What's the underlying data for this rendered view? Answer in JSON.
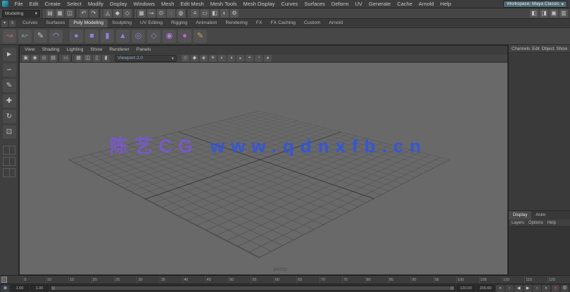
{
  "menubar": {
    "items": [
      "File",
      "Edit",
      "Create",
      "Select",
      "Modify",
      "Display",
      "Windows",
      "Mesh",
      "Edit Mesh",
      "Mesh Tools",
      "Mesh Display",
      "Curves",
      "Surfaces",
      "Deform",
      "UV",
      "Generate",
      "Cache",
      "Arnold",
      "Help"
    ],
    "workspace": "Workspace: Maya Classic",
    "workspace_arrow": "▾"
  },
  "statusline": {
    "menuset": "Modeling",
    "menuset_arrow": "▾",
    "icons": [
      {
        "name": "separator",
        "glyph": ""
      },
      {
        "name": "new-scene-icon",
        "glyph": "▤"
      },
      {
        "name": "open-scene-icon",
        "glyph": "▦"
      },
      {
        "name": "save-scene-icon",
        "glyph": "◫"
      },
      {
        "name": "separator",
        "glyph": ""
      },
      {
        "name": "undo-icon",
        "glyph": "↶"
      },
      {
        "name": "redo-icon",
        "glyph": "↷"
      },
      {
        "name": "separator",
        "glyph": ""
      },
      {
        "name": "select-hierarchy-icon",
        "glyph": "◬"
      },
      {
        "name": "select-object-icon",
        "glyph": "◆"
      },
      {
        "name": "select-component-icon",
        "glyph": "◇"
      },
      {
        "name": "separator",
        "glyph": ""
      },
      {
        "name": "snap-grid-icon",
        "glyph": "▦"
      },
      {
        "name": "snap-curve-icon",
        "glyph": "↝"
      },
      {
        "name": "snap-point-icon",
        "glyph": "⊙"
      },
      {
        "name": "snap-plane-icon",
        "glyph": "◌"
      },
      {
        "name": "make-live-icon",
        "glyph": "◍"
      },
      {
        "name": "separator",
        "glyph": ""
      },
      {
        "name": "construction-history-icon",
        "glyph": "≡"
      },
      {
        "name": "open-render-view-icon",
        "glyph": "▭"
      },
      {
        "name": "render-frame-icon",
        "glyph": "◧"
      },
      {
        "name": "ipr-render-icon",
        "glyph": "◐"
      },
      {
        "name": "render-settings-icon",
        "glyph": "⚙"
      }
    ],
    "right_icons": [
      {
        "name": "modeling-toolkit-icon",
        "glyph": "◧"
      },
      {
        "name": "attribute-editor-icon",
        "glyph": "◨"
      },
      {
        "name": "tool-settings-icon",
        "glyph": "▣"
      },
      {
        "name": "channel-box-icon",
        "glyph": "▥"
      }
    ]
  },
  "shelf": {
    "menu_icons": [
      {
        "name": "shelf-tab-menu-icon",
        "glyph": "▾"
      },
      {
        "name": "shelf-edit-menu-icon",
        "glyph": "≡"
      }
    ],
    "tabs": [
      {
        "label": "Curves",
        "active": false
      },
      {
        "label": "Surfaces",
        "active": false
      },
      {
        "label": "Poly Modeling",
        "active": true
      },
      {
        "label": "Sculpting",
        "active": false
      },
      {
        "label": "UV Editing",
        "active": false
      },
      {
        "label": "Rigging",
        "active": false
      },
      {
        "label": "Animation",
        "active": false
      },
      {
        "label": "Rendering",
        "active": false
      },
      {
        "label": "FX",
        "active": false
      },
      {
        "label": "FX Caching",
        "active": false
      },
      {
        "label": "Custom",
        "active": false
      },
      {
        "label": "Arnold",
        "active": false
      }
    ],
    "icons": [
      {
        "name": "ep-curve-icon",
        "glyph": "↝",
        "color": "#cc6666"
      },
      {
        "name": "cv-curve-icon",
        "glyph": "↜",
        "color": "#66aa88"
      },
      {
        "name": "pencil-curve-icon",
        "glyph": "✎",
        "color": "#cccccc"
      },
      {
        "name": "arc-tool-icon",
        "glyph": "◠",
        "color": "#99aadd"
      },
      {
        "name": "shelf-separator",
        "glyph": "",
        "color": ""
      },
      {
        "name": "poly-sphere-icon",
        "glyph": "●",
        "color": "#8f7fd9"
      },
      {
        "name": "poly-cube-icon",
        "glyph": "■",
        "color": "#8f7fd9"
      },
      {
        "name": "poly-cylinder-icon",
        "glyph": "▮",
        "color": "#8f7fd9"
      },
      {
        "name": "poly-cone-icon",
        "glyph": "▲",
        "color": "#8f7fd9"
      },
      {
        "name": "poly-torus-icon",
        "glyph": "◎",
        "color": "#8f7fd9"
      },
      {
        "name": "poly-plane-icon",
        "glyph": "◇",
        "color": "#8f7fd9"
      },
      {
        "name": "poly-disc-icon",
        "glyph": "◉",
        "color": "#b57fd9"
      },
      {
        "name": "sculpt-sphere-icon",
        "glyph": "●",
        "color": "#c75fd0"
      },
      {
        "name": "sculpt-brush-icon",
        "glyph": "✎",
        "color": "#d0a05f"
      }
    ]
  },
  "toolbox": {
    "tools": [
      {
        "name": "select-tool-icon",
        "glyph": "►"
      },
      {
        "name": "lasso-tool-icon",
        "glyph": "∽"
      },
      {
        "name": "paint-select-tool-icon",
        "glyph": "✎"
      },
      {
        "name": "move-tool-icon",
        "glyph": "✚"
      },
      {
        "name": "rotate-tool-icon",
        "glyph": "↻"
      },
      {
        "name": "scale-tool-icon",
        "glyph": "⊡"
      }
    ],
    "layouts": [
      {
        "name": "layout-single-button"
      },
      {
        "name": "layout-four-pane-button"
      },
      {
        "name": "layout-persp-outliner-button"
      }
    ]
  },
  "viewportpanel": {
    "menus": [
      "View",
      "Shading",
      "Lighting",
      "Show",
      "Renderer",
      "Panels"
    ],
    "toolbar_left": [
      {
        "name": "camera-select-icon",
        "glyph": "▣"
      },
      {
        "name": "camera-lock-icon",
        "glyph": "◉"
      },
      {
        "name": "camera-attributes-icon",
        "glyph": "◎"
      },
      {
        "name": "bookmark-icon",
        "glyph": "▤"
      },
      {
        "name": "separator",
        "glyph": ""
      },
      {
        "name": "image-plane-icon",
        "glyph": "▭"
      },
      {
        "name": "separator",
        "glyph": ""
      },
      {
        "name": "grid-toggle-icon",
        "glyph": "▦"
      },
      {
        "name": "film-gate-icon",
        "glyph": "◫"
      },
      {
        "name": "resolution-gate-icon",
        "glyph": "▯"
      },
      {
        "name": "gate-mask-icon",
        "glyph": "▮"
      }
    ],
    "renderer_dropdown": "Viewport 2.0",
    "dropdown_arrow": "▾",
    "toolbar_right": [
      {
        "name": "wireframe-icon",
        "glyph": "◇"
      },
      {
        "name": "shaded-icon",
        "glyph": "◆"
      },
      {
        "name": "textured-icon",
        "glyph": "◈"
      },
      {
        "name": "lights-icon",
        "glyph": "☀"
      },
      {
        "name": "shadows-icon",
        "glyph": "◐"
      },
      {
        "name": "screen-ao-icon",
        "glyph": "◑"
      },
      {
        "name": "motion-blur-icon",
        "glyph": "◒"
      },
      {
        "name": "anti-alias-icon",
        "glyph": "◓"
      },
      {
        "name": "xray-icon",
        "glyph": "◔"
      },
      {
        "name": "isolate-select-icon",
        "glyph": "◕"
      }
    ],
    "camera_label": "persp",
    "watermark_cn": "陈艺CG",
    "watermark_url": "www.qdnxfb.cn",
    "watermark_color_cn": "#7b57d8",
    "watermark_color_url": "#2e55e8"
  },
  "channel_box": {
    "menus": [
      "Channels",
      "Edit",
      "Object",
      "Show"
    ]
  },
  "layer_editor": {
    "tabs": [
      {
        "label": "Display",
        "active": true
      },
      {
        "label": "Anim",
        "active": false
      }
    ],
    "menus": [
      "Layers",
      "Options",
      "Help"
    ]
  },
  "timeline": {
    "ticks": [
      "1",
      "5",
      "10",
      "15",
      "20",
      "25",
      "30",
      "35",
      "40",
      "45",
      "50",
      "55",
      "60",
      "65",
      "70",
      "75",
      "80",
      "85",
      "90",
      "95",
      "100",
      "105",
      "110",
      "115",
      "120"
    ]
  },
  "range_bar": {
    "key_glyph": "◆",
    "left_fields": [
      "1.00",
      "1.00"
    ],
    "right_fields": [
      "120.00",
      "200.00"
    ],
    "transport": [
      {
        "name": "go-to-start-button",
        "glyph": "«"
      },
      {
        "name": "step-back-key-button",
        "glyph": "‹"
      },
      {
        "name": "step-back-frame-button",
        "glyph": "◀"
      },
      {
        "name": "play-forward-button",
        "glyph": "▶"
      },
      {
        "name": "step-forward-key-button",
        "glyph": "›"
      },
      {
        "name": "go-to-end-button",
        "glyph": "»"
      }
    ],
    "autokey_glyph": "●",
    "prefs_glyph": "⚙"
  }
}
